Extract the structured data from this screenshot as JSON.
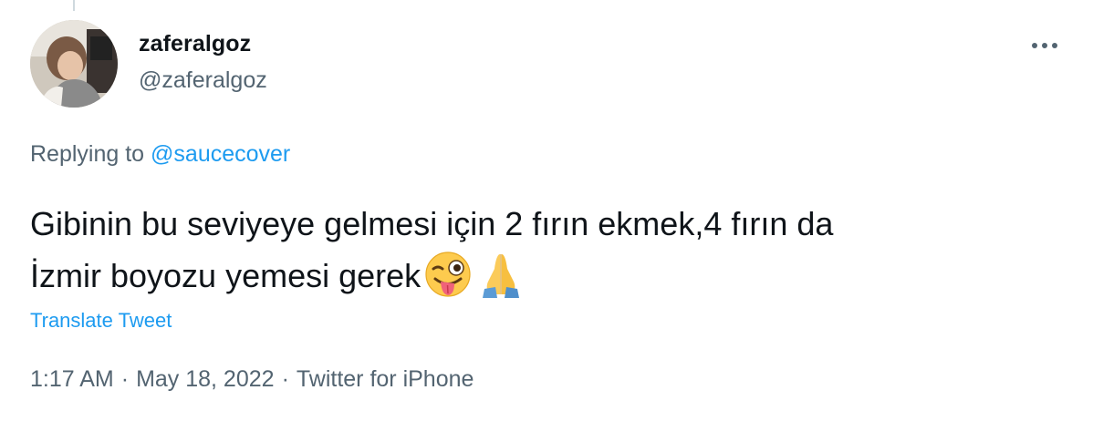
{
  "tweet": {
    "display_name": "zaferalgoz",
    "handle": "@zaferalgoz",
    "replying_prefix": "Replying to",
    "replying_to": "@saucecover",
    "text_line1": "Gibinin bu seviyeye gelmesi için 2 fırın ekmek,4 fırın da",
    "text_line2": "İzmir boyozu yemesi gerek",
    "emojis": [
      "winking-face-with-tongue-emoji",
      "folded-hands-emoji"
    ],
    "translate_label": "Translate Tweet",
    "time": "1:17 AM",
    "separator": "·",
    "date": "May 18, 2022",
    "source": "Twitter for iPhone"
  },
  "icons": {
    "more": "more-options-icon"
  },
  "colors": {
    "text": "#0f1419",
    "secondary": "#536471",
    "link": "#1d9bf0",
    "thread_line": "#cfd9de"
  }
}
